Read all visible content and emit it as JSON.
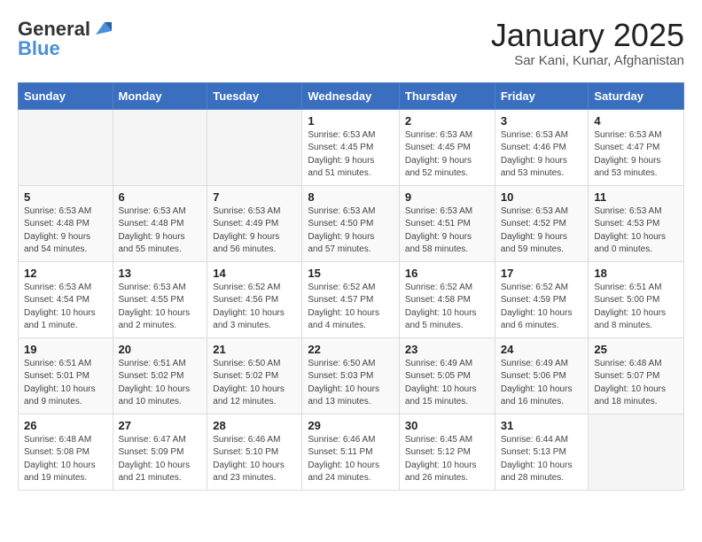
{
  "header": {
    "logo_general": "General",
    "logo_blue": "Blue",
    "month_year": "January 2025",
    "location": "Sar Kani, Kunar, Afghanistan"
  },
  "days_of_week": [
    "Sunday",
    "Monday",
    "Tuesday",
    "Wednesday",
    "Thursday",
    "Friday",
    "Saturday"
  ],
  "weeks": [
    [
      {
        "day": "",
        "info": ""
      },
      {
        "day": "",
        "info": ""
      },
      {
        "day": "",
        "info": ""
      },
      {
        "day": "1",
        "info": "Sunrise: 6:53 AM\nSunset: 4:45 PM\nDaylight: 9 hours\nand 51 minutes."
      },
      {
        "day": "2",
        "info": "Sunrise: 6:53 AM\nSunset: 4:45 PM\nDaylight: 9 hours\nand 52 minutes."
      },
      {
        "day": "3",
        "info": "Sunrise: 6:53 AM\nSunset: 4:46 PM\nDaylight: 9 hours\nand 53 minutes."
      },
      {
        "day": "4",
        "info": "Sunrise: 6:53 AM\nSunset: 4:47 PM\nDaylight: 9 hours\nand 53 minutes."
      }
    ],
    [
      {
        "day": "5",
        "info": "Sunrise: 6:53 AM\nSunset: 4:48 PM\nDaylight: 9 hours\nand 54 minutes."
      },
      {
        "day": "6",
        "info": "Sunrise: 6:53 AM\nSunset: 4:48 PM\nDaylight: 9 hours\nand 55 minutes."
      },
      {
        "day": "7",
        "info": "Sunrise: 6:53 AM\nSunset: 4:49 PM\nDaylight: 9 hours\nand 56 minutes."
      },
      {
        "day": "8",
        "info": "Sunrise: 6:53 AM\nSunset: 4:50 PM\nDaylight: 9 hours\nand 57 minutes."
      },
      {
        "day": "9",
        "info": "Sunrise: 6:53 AM\nSunset: 4:51 PM\nDaylight: 9 hours\nand 58 minutes."
      },
      {
        "day": "10",
        "info": "Sunrise: 6:53 AM\nSunset: 4:52 PM\nDaylight: 9 hours\nand 59 minutes."
      },
      {
        "day": "11",
        "info": "Sunrise: 6:53 AM\nSunset: 4:53 PM\nDaylight: 10 hours\nand 0 minutes."
      }
    ],
    [
      {
        "day": "12",
        "info": "Sunrise: 6:53 AM\nSunset: 4:54 PM\nDaylight: 10 hours\nand 1 minute."
      },
      {
        "day": "13",
        "info": "Sunrise: 6:53 AM\nSunset: 4:55 PM\nDaylight: 10 hours\nand 2 minutes."
      },
      {
        "day": "14",
        "info": "Sunrise: 6:52 AM\nSunset: 4:56 PM\nDaylight: 10 hours\nand 3 minutes."
      },
      {
        "day": "15",
        "info": "Sunrise: 6:52 AM\nSunset: 4:57 PM\nDaylight: 10 hours\nand 4 minutes."
      },
      {
        "day": "16",
        "info": "Sunrise: 6:52 AM\nSunset: 4:58 PM\nDaylight: 10 hours\nand 5 minutes."
      },
      {
        "day": "17",
        "info": "Sunrise: 6:52 AM\nSunset: 4:59 PM\nDaylight: 10 hours\nand 6 minutes."
      },
      {
        "day": "18",
        "info": "Sunrise: 6:51 AM\nSunset: 5:00 PM\nDaylight: 10 hours\nand 8 minutes."
      }
    ],
    [
      {
        "day": "19",
        "info": "Sunrise: 6:51 AM\nSunset: 5:01 PM\nDaylight: 10 hours\nand 9 minutes."
      },
      {
        "day": "20",
        "info": "Sunrise: 6:51 AM\nSunset: 5:02 PM\nDaylight: 10 hours\nand 10 minutes."
      },
      {
        "day": "21",
        "info": "Sunrise: 6:50 AM\nSunset: 5:02 PM\nDaylight: 10 hours\nand 12 minutes."
      },
      {
        "day": "22",
        "info": "Sunrise: 6:50 AM\nSunset: 5:03 PM\nDaylight: 10 hours\nand 13 minutes."
      },
      {
        "day": "23",
        "info": "Sunrise: 6:49 AM\nSunset: 5:05 PM\nDaylight: 10 hours\nand 15 minutes."
      },
      {
        "day": "24",
        "info": "Sunrise: 6:49 AM\nSunset: 5:06 PM\nDaylight: 10 hours\nand 16 minutes."
      },
      {
        "day": "25",
        "info": "Sunrise: 6:48 AM\nSunset: 5:07 PM\nDaylight: 10 hours\nand 18 minutes."
      }
    ],
    [
      {
        "day": "26",
        "info": "Sunrise: 6:48 AM\nSunset: 5:08 PM\nDaylight: 10 hours\nand 19 minutes."
      },
      {
        "day": "27",
        "info": "Sunrise: 6:47 AM\nSunset: 5:09 PM\nDaylight: 10 hours\nand 21 minutes."
      },
      {
        "day": "28",
        "info": "Sunrise: 6:46 AM\nSunset: 5:10 PM\nDaylight: 10 hours\nand 23 minutes."
      },
      {
        "day": "29",
        "info": "Sunrise: 6:46 AM\nSunset: 5:11 PM\nDaylight: 10 hours\nand 24 minutes."
      },
      {
        "day": "30",
        "info": "Sunrise: 6:45 AM\nSunset: 5:12 PM\nDaylight: 10 hours\nand 26 minutes."
      },
      {
        "day": "31",
        "info": "Sunrise: 6:44 AM\nSunset: 5:13 PM\nDaylight: 10 hours\nand 28 minutes."
      },
      {
        "day": "",
        "info": ""
      }
    ]
  ]
}
